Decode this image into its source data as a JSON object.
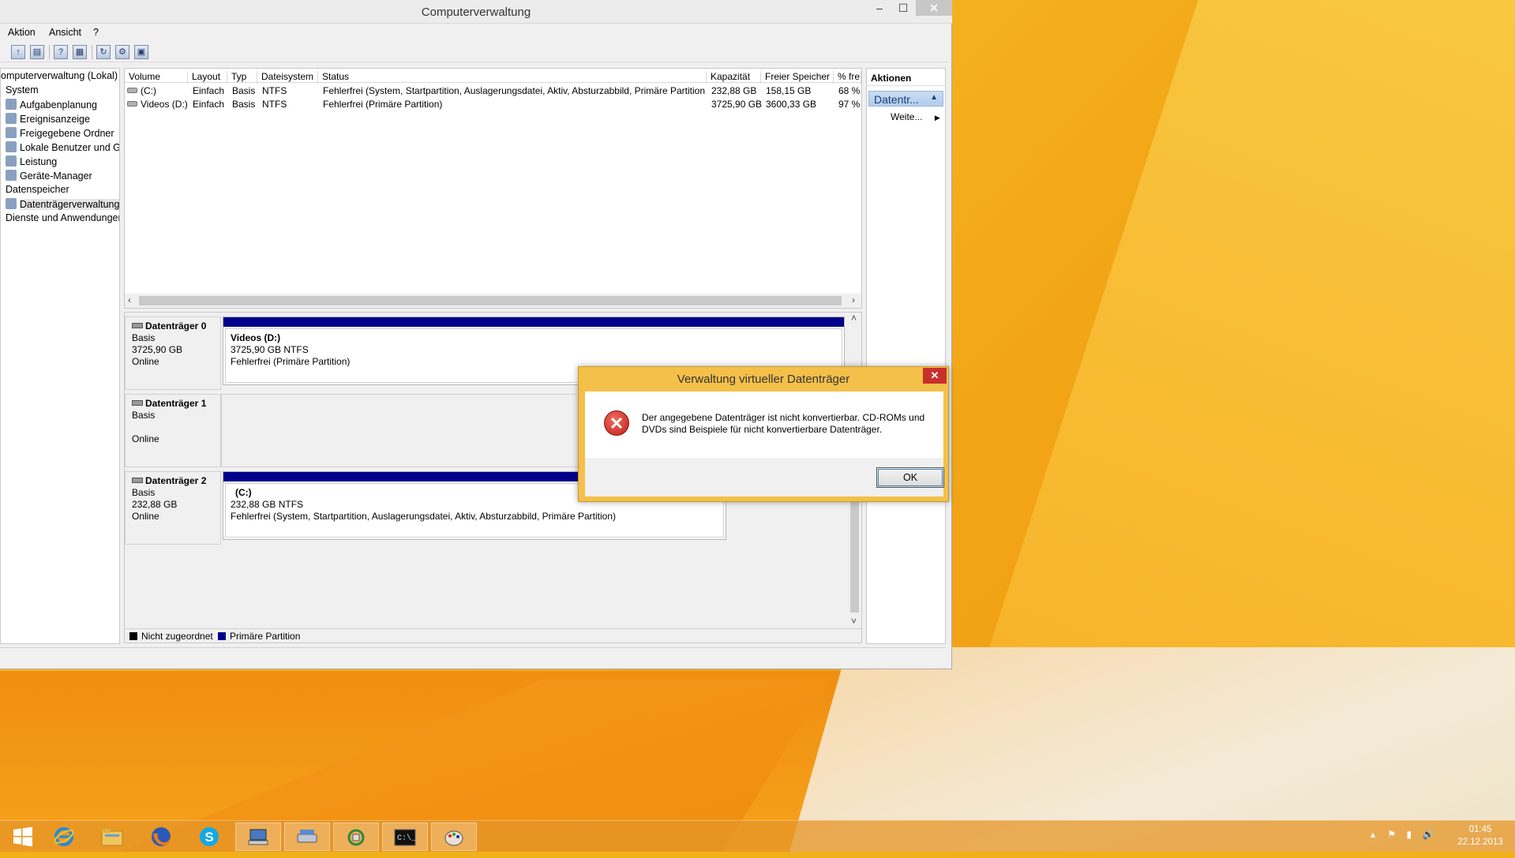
{
  "window": {
    "title": "Computerverwaltung",
    "min": "–",
    "max": "☐",
    "close": "✕"
  },
  "menu": [
    "Aktion",
    "Ansicht",
    "?"
  ],
  "tree": [
    {
      "label": "omputerverwaltung (Lokal)",
      "indent": 0,
      "icon": false
    },
    {
      "label": "System",
      "indent": 6,
      "icon": false
    },
    {
      "label": "Aufgabenplanung",
      "indent": 6,
      "icon": true,
      "icon_name": "clock-icon"
    },
    {
      "label": "Ereignisanzeige",
      "indent": 6,
      "icon": true,
      "icon_name": "event-viewer-icon"
    },
    {
      "label": "Freigegebene Ordner",
      "indent": 6,
      "icon": true,
      "icon_name": "shared-folder-icon"
    },
    {
      "label": "Lokale Benutzer und Gr",
      "indent": 6,
      "icon": true,
      "icon_name": "users-icon"
    },
    {
      "label": "Leistung",
      "indent": 6,
      "icon": true,
      "icon_name": "performance-icon"
    },
    {
      "label": "Geräte-Manager",
      "indent": 6,
      "icon": true,
      "icon_name": "device-manager-icon"
    },
    {
      "label": "Datenspeicher",
      "indent": 6,
      "icon": false
    },
    {
      "label": "Datenträgerverwaltung",
      "indent": 6,
      "icon": true,
      "icon_name": "disk-management-icon",
      "selected": true
    },
    {
      "label": "Dienste und Anwendungen",
      "indent": 6,
      "icon": false
    }
  ],
  "columns": [
    "Volume",
    "Layout",
    "Typ",
    "Dateisystem",
    "Status",
    "Kapazität",
    "Freier Speicher",
    "% fre"
  ],
  "volumes": [
    {
      "volume": "(C:)",
      "layout": "Einfach",
      "typ": "Basis",
      "fs": "NTFS",
      "status": "Fehlerfrei (System, Startpartition, Auslagerungsdatei, Aktiv, Absturzabbild, Primäre Partition)",
      "capacity": "232,88 GB",
      "free": "158,15 GB",
      "pct": "68 %"
    },
    {
      "volume": "Videos (D:)",
      "layout": "Einfach",
      "typ": "Basis",
      "fs": "NTFS",
      "status": "Fehlerfrei (Primäre Partition)",
      "capacity": "3725,90 GB",
      "free": "3600,33 GB",
      "pct": "97 %"
    }
  ],
  "disks": {
    "d0": {
      "name": "Datenträger 0",
      "type": "Basis",
      "size": "3725,90 GB",
      "state": "Online",
      "part_name": "Videos  (D:)",
      "part_size": "3725,90 GB NTFS",
      "part_status": "Fehlerfrei (Primäre Partition)"
    },
    "d1": {
      "name": "Datenträger 1",
      "type": "Basis",
      "size": "",
      "state": "Online"
    },
    "d2": {
      "name": "Datenträger 2",
      "type": "Basis",
      "size": "232,88 GB",
      "state": "Online",
      "part_name": "(C:)",
      "part_size": "232,88 GB NTFS",
      "part_status": "Fehlerfrei (System, Startpartition, Auslagerungsdatei, Aktiv, Absturzabbild, Primäre Partition)"
    }
  },
  "legend": {
    "unallocated": "Nicht zugeordnet",
    "primary": "Primäre Partition",
    "unallocated_color": "#000000",
    "primary_color": "#00008b"
  },
  "actions": {
    "header": "Aktionen",
    "selected": "Datentr...",
    "more": "Weite..."
  },
  "dialog": {
    "title": "Verwaltung virtueller Datenträger",
    "close": "✕",
    "message": "Der angegebene Datenträger ist nicht konvertierbar. CD-ROMs und DVDs sind  Beispiele für nicht konvertierbare Datenträger.",
    "ok": "OK",
    "icon": "error-icon"
  },
  "taskbar": {
    "apps": [
      "start-icon",
      "internet-explorer-icon",
      "file-explorer-icon",
      "firefox-icon",
      "skype-icon",
      "computer-management-icon",
      "disk-icon",
      "network-icon",
      "command-prompt-icon",
      "paint-icon"
    ],
    "time": "01:45",
    "date": "22.12.2013"
  }
}
